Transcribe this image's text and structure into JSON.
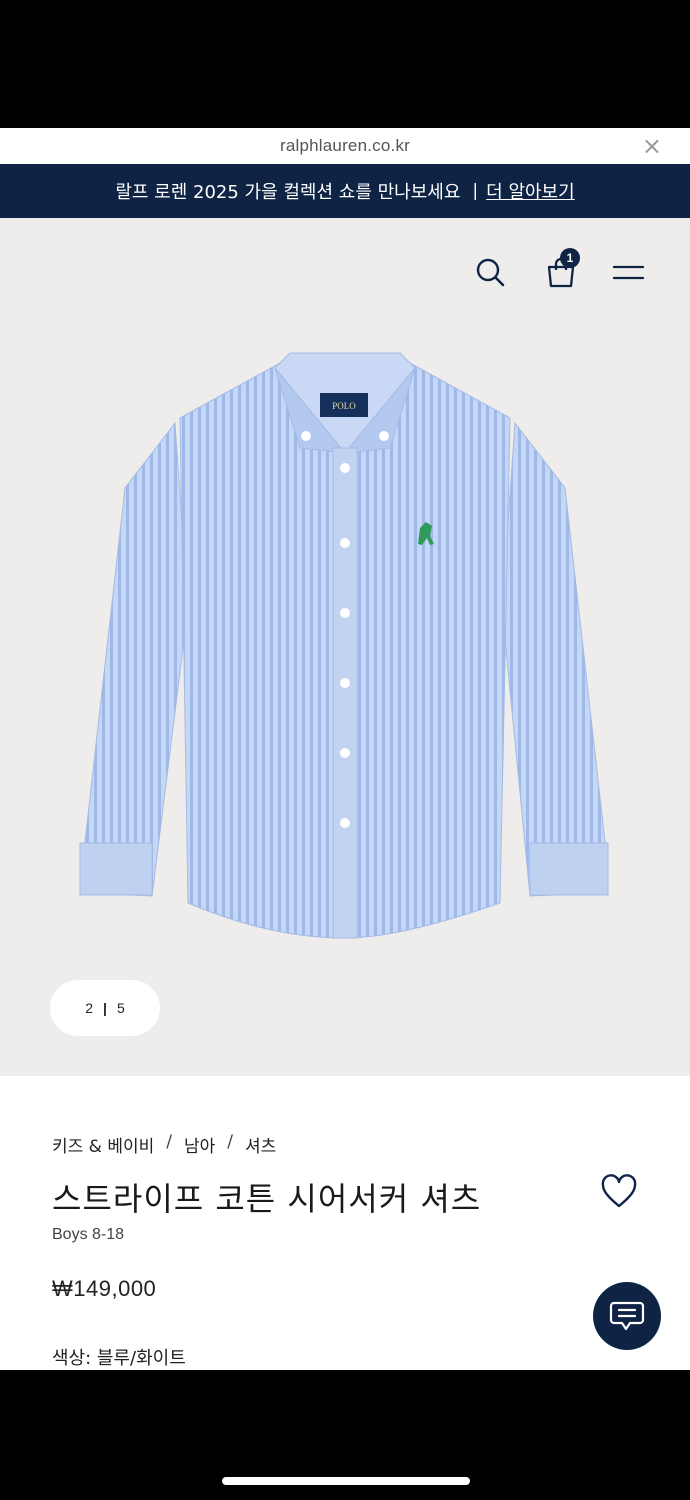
{
  "browser": {
    "url": "ralphlauren.co.kr",
    "close_glyph": "×"
  },
  "promo": {
    "text": "랄프 로렌 2025 가을 컬렉션 쇼를 만나보세요",
    "separator": "|",
    "link": "더 알아보기"
  },
  "header": {
    "cart_count": "1"
  },
  "gallery": {
    "current": "2",
    "separator": "|",
    "total": "5",
    "logo_text": "POLO"
  },
  "product": {
    "breadcrumbs": [
      "키즈 & 베이비",
      "남아",
      "셔츠"
    ],
    "breadcrumb_sep": "/",
    "title": "스트라이프 코튼 시어서커 셔츠",
    "size_range": "Boys 8-18",
    "price": "₩149,000",
    "color_label": "색상:",
    "color_value": "블루/화이트"
  },
  "colors": {
    "navy": "#0f2345",
    "hero_bg": "#eeedec",
    "shirt_blue": "#b7cdf0"
  }
}
